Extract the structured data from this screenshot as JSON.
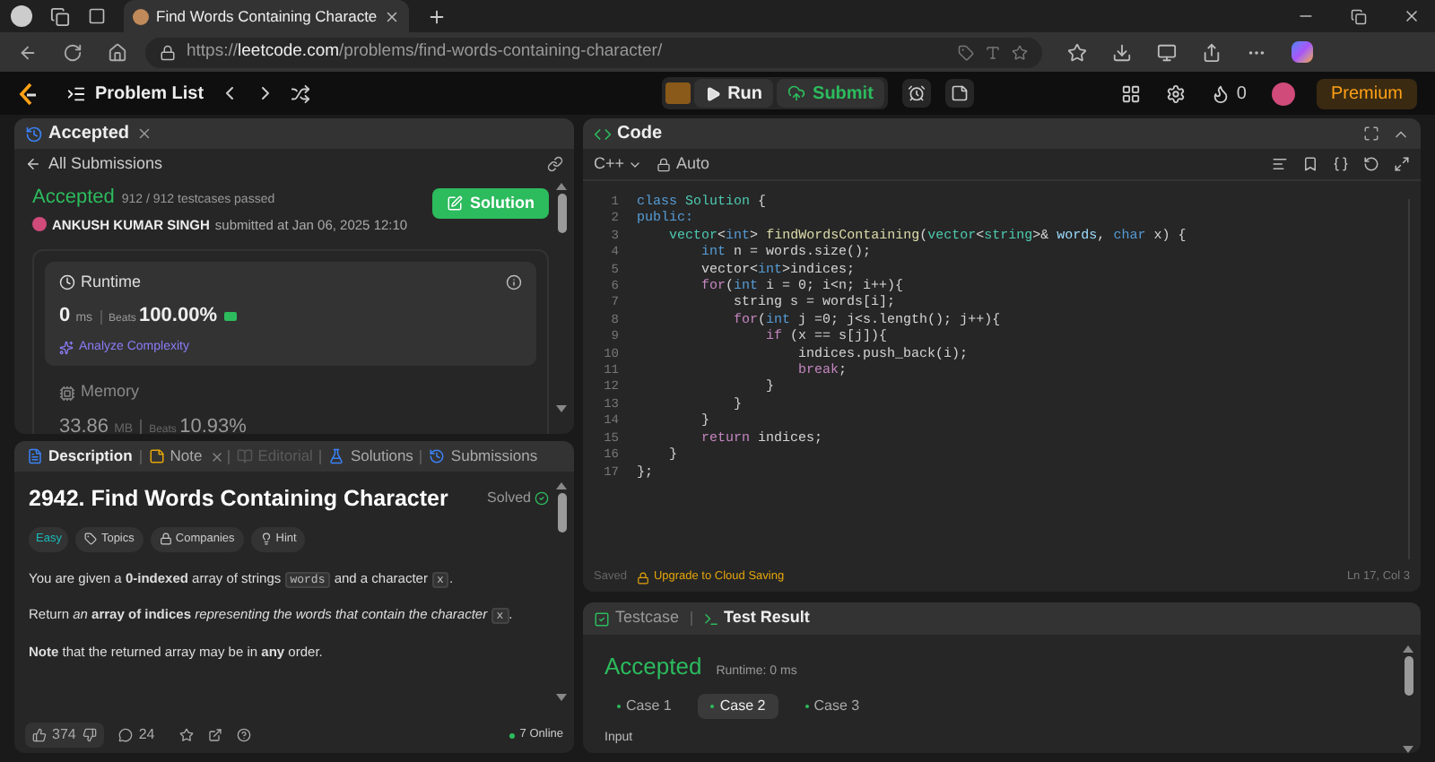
{
  "browser": {
    "tab_title": "Find Words Containing Characte",
    "url_prefix": "https://",
    "url_host": "leetcode.com",
    "url_path": "/problems/find-words-containing-character/"
  },
  "nav": {
    "problem_list": "Problem List",
    "run": "Run",
    "submit": "Submit",
    "streak": "0",
    "premium": "Premium"
  },
  "submission_panel": {
    "tab": "Accepted",
    "back": "All Submissions",
    "status": "Accepted",
    "passed": "912 / 912 testcases passed",
    "author": "ANKUSH KUMAR SINGH",
    "submitted": "submitted at Jan 06, 2025 12:10",
    "solution_button": "Solution",
    "runtime": {
      "label": "Runtime",
      "value": "0",
      "unit": "ms",
      "beats_label": "Beats",
      "beats": "100.00%",
      "analyze": "Analyze Complexity"
    },
    "memory": {
      "label": "Memory",
      "value": "33.86",
      "unit": "MB",
      "beats_label": "Beats",
      "beats": "10.93%"
    }
  },
  "description_panel": {
    "tabs": [
      {
        "label": "Description",
        "selected": true,
        "disabled": false
      },
      {
        "label": "Note",
        "selected": false,
        "disabled": false
      },
      {
        "label": "Editorial",
        "selected": false,
        "disabled": true
      },
      {
        "label": "Solutions",
        "selected": false,
        "disabled": false
      },
      {
        "label": "Submissions",
        "selected": false,
        "disabled": false
      }
    ],
    "title": "2942. Find Words Containing Character",
    "status": "Solved",
    "difficulty": "Easy",
    "chips": [
      "Topics",
      "Companies",
      "Hint"
    ],
    "paragraphs": [
      [
        {
          "t": "You are given a **0-indexed** array of strings ",
          "kind": "text"
        },
        {
          "t": "words",
          "kind": "code"
        },
        {
          "t": " and a character ",
          "kind": "text"
        },
        {
          "t": "x",
          "kind": "code"
        },
        {
          "t": ".",
          "kind": "text"
        }
      ],
      [
        {
          "t": "Return *an* **array of indices** *representing the words that contain the character* ",
          "kind": "text"
        },
        {
          "t": "x",
          "kind": "code"
        },
        {
          "t": ".",
          "kind": "text"
        }
      ],
      [
        {
          "t": "**Note** that the returned array may be in **any** order.",
          "kind": "text"
        }
      ]
    ],
    "likes": "374",
    "comments": "24",
    "online": "7 Online"
  },
  "code_panel": {
    "title": "Code",
    "language": "C++",
    "mode": "Auto",
    "lines": [
      {
        "n": "1",
        "segs": [
          {
            "t": "class ",
            "kind": "kw"
          },
          {
            "t": "Solution",
            "kind": "type"
          },
          {
            "t": " {",
            "kind": "p"
          }
        ]
      },
      {
        "n": "2",
        "segs": [
          {
            "t": "public:",
            "kind": "kw"
          }
        ]
      },
      {
        "n": "3",
        "segs": [
          {
            "t": "    vector",
            "kind": "type"
          },
          {
            "t": "<",
            "kind": "p"
          },
          {
            "t": "int",
            "kind": "kw"
          },
          {
            "t": "> ",
            "kind": "p"
          },
          {
            "t": "findWordsContaining",
            "kind": "fn"
          },
          {
            "t": "(",
            "kind": "p"
          },
          {
            "t": "vector",
            "kind": "type"
          },
          {
            "t": "<",
            "kind": "p"
          },
          {
            "t": "string",
            "kind": "type"
          },
          {
            "t": ">& ",
            "kind": "p"
          },
          {
            "t": "words",
            "kind": "var"
          },
          {
            "t": ", ",
            "kind": "p"
          },
          {
            "t": "char",
            "kind": "kw"
          },
          {
            "t": " x) {",
            "kind": "p"
          }
        ]
      },
      {
        "n": "4",
        "segs": [
          {
            "t": "        int",
            "kind": "kw"
          },
          {
            "t": " n = words.size();",
            "kind": "p"
          }
        ]
      },
      {
        "n": "5",
        "segs": [
          {
            "t": "        vector<",
            "kind": "p"
          },
          {
            "t": "int",
            "kind": "kw"
          },
          {
            "t": ">indices;",
            "kind": "p"
          }
        ]
      },
      {
        "n": "6",
        "segs": [
          {
            "t": "        for",
            "kind": "ctl"
          },
          {
            "t": "(",
            "kind": "p"
          },
          {
            "t": "int",
            "kind": "kw"
          },
          {
            "t": " i = 0; i<n; i++){",
            "kind": "p"
          }
        ]
      },
      {
        "n": "7",
        "segs": [
          {
            "t": "            string s = words[i];",
            "kind": "p"
          }
        ]
      },
      {
        "n": "8",
        "segs": [
          {
            "t": "            for",
            "kind": "ctl"
          },
          {
            "t": "(",
            "kind": "p"
          },
          {
            "t": "int",
            "kind": "kw"
          },
          {
            "t": " j =0; j<s.length(); j++){",
            "kind": "p"
          }
        ]
      },
      {
        "n": "9",
        "segs": [
          {
            "t": "                if",
            "kind": "ctl"
          },
          {
            "t": " (x == s[j]){",
            "kind": "p"
          }
        ]
      },
      {
        "n": "10",
        "segs": [
          {
            "t": "                    indices.push_back(i);",
            "kind": "p"
          }
        ]
      },
      {
        "n": "11",
        "segs": [
          {
            "t": "                    break",
            "kind": "ctl"
          },
          {
            "t": ";",
            "kind": "p"
          }
        ]
      },
      {
        "n": "12",
        "segs": [
          {
            "t": "                }",
            "kind": "p"
          }
        ]
      },
      {
        "n": "13",
        "segs": [
          {
            "t": "            }",
            "kind": "p"
          }
        ]
      },
      {
        "n": "14",
        "segs": [
          {
            "t": "        }",
            "kind": "p"
          }
        ]
      },
      {
        "n": "15",
        "segs": [
          {
            "t": "        return",
            "kind": "ctl"
          },
          {
            "t": " indices;",
            "kind": "p"
          }
        ]
      },
      {
        "n": "16",
        "segs": [
          {
            "t": "    }",
            "kind": "p"
          }
        ]
      },
      {
        "n": "17",
        "segs": [
          {
            "t": "};",
            "kind": "p"
          }
        ]
      }
    ],
    "saved": "Saved",
    "upgrade": "Upgrade to Cloud Saving",
    "cursor": "Ln 17, Col 3"
  },
  "test_panel": {
    "tabs": [
      {
        "label": "Testcase",
        "selected": false
      },
      {
        "label": "Test Result",
        "selected": true
      }
    ],
    "status": "Accepted",
    "runtime": "Runtime: 0 ms",
    "cases": [
      {
        "label": "Case 1",
        "selected": false
      },
      {
        "label": "Case 2",
        "selected": true
      },
      {
        "label": "Case 3",
        "selected": false
      }
    ],
    "input_label": "Input"
  }
}
